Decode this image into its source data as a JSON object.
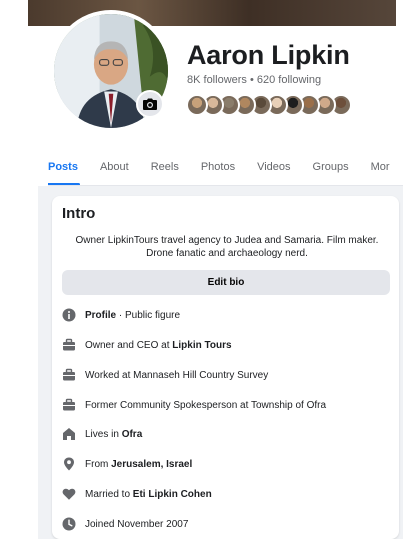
{
  "profile": {
    "name": "Aaron Lipkin",
    "follows": "8K followers • 620 following"
  },
  "friends": {
    "colors": [
      "#c7a17a",
      "#d8b89a",
      "#8a7d6b",
      "#b0875f",
      "#5a4a3a",
      "#e8d0b8",
      "#1e1e1e",
      "#9a6f4a",
      "#cfa98a",
      "#6d4f3b"
    ]
  },
  "tabs": [
    "Posts",
    "About",
    "Reels",
    "Photos",
    "Videos",
    "Groups",
    "Mor"
  ],
  "intro": {
    "title": "Intro",
    "bio_line1": "Owner LipkinTours travel agency to Judea and Samaria. Film maker.",
    "bio_line2": "Drone fanatic and archaeology nerd.",
    "edit_bio": "Edit bio",
    "details": [
      {
        "icon": "info-icon",
        "bold": "Profile",
        "text": " · Public figure"
      },
      {
        "icon": "briefcase-icon",
        "prefix": "Owner and CEO at ",
        "bold": "Lipkin Tours"
      },
      {
        "icon": "briefcase-icon",
        "prefix": "Worked at Mannaseh Hill Country Survey"
      },
      {
        "icon": "briefcase-icon",
        "prefix": "Former Community Spokesperson at Township of Ofra"
      },
      {
        "icon": "home-icon",
        "prefix": "Lives in ",
        "bold": "Ofra"
      },
      {
        "icon": "location-pin-icon",
        "prefix": "From ",
        "bold": "Jerusalem, Israel"
      },
      {
        "icon": "heart-icon",
        "prefix": "Married to ",
        "bold": "Eti Lipkin Cohen"
      },
      {
        "icon": "clock-icon",
        "prefix": "Joined November 2007"
      }
    ]
  },
  "colors": {
    "accent": "#1877f2",
    "icon_gray": "#65676b"
  }
}
